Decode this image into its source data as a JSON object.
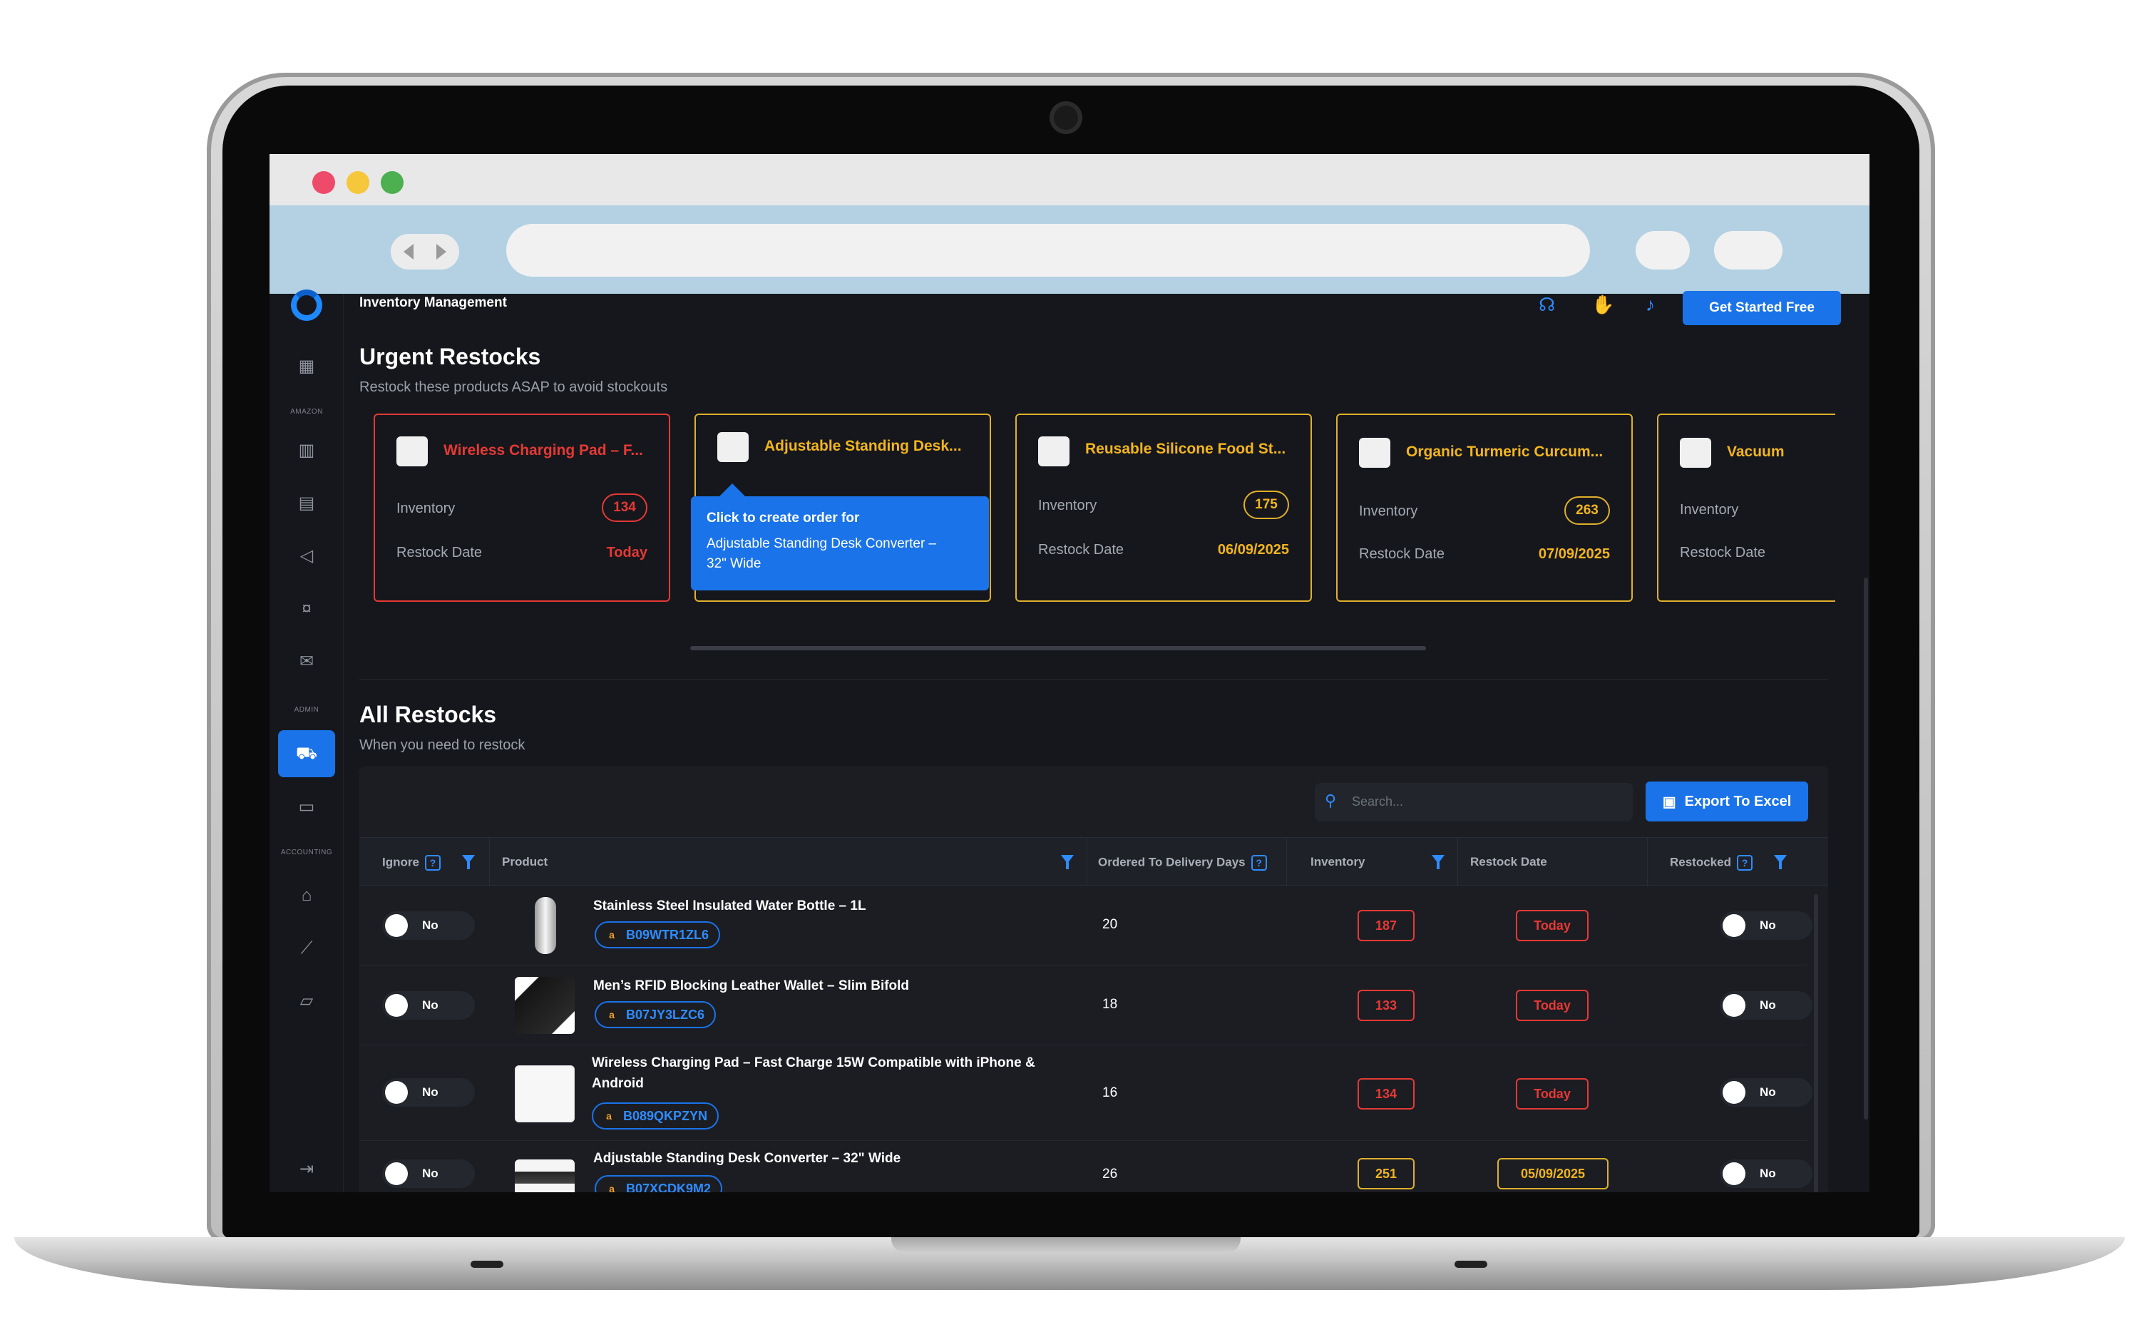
{
  "app": {
    "title": "Inventory Management",
    "cta_label": "Get Started Free"
  },
  "sidebar": {
    "sections": [
      "AMAZON",
      "ADMIN",
      "ACCOUNTING"
    ]
  },
  "urgent": {
    "title": "Urgent Restocks",
    "subtitle": "Restock these products ASAP to avoid stockouts",
    "inventory_label": "Inventory",
    "restock_date_label": "Restock Date",
    "cards": [
      {
        "name": "Wireless Charging Pad – F...",
        "inventory": "134",
        "date": "Today"
      },
      {
        "name": "Adjustable Standing Desk...",
        "inventory": "",
        "date": ""
      },
      {
        "name": "Reusable Silicone Food St...",
        "inventory": "175",
        "date": "06/09/2025"
      },
      {
        "name": "Organic Turmeric Curcum...",
        "inventory": "263",
        "date": "07/09/2025"
      },
      {
        "name": "Vacuum",
        "inventory": "",
        "date": ""
      }
    ],
    "tooltip": {
      "line1": "Click to create order for",
      "line2": "Adjustable Standing Desk Converter –",
      "line3": "32\" Wide"
    }
  },
  "all": {
    "title": "All Restocks",
    "subtitle": "When you need to restock",
    "search_placeholder": "Search...",
    "export_label": "Export To Excel",
    "columns": {
      "ignore": "Ignore",
      "product": "Product",
      "days": "Ordered To Delivery Days",
      "inventory": "Inventory",
      "restock_date": "Restock Date",
      "restocked": "Restocked"
    },
    "rows": [
      {
        "ignore": "No",
        "name": "Stainless Steel Insulated Water Bottle – 1L",
        "asin": "B09WTR1ZL6",
        "days": "20",
        "inventory": "187",
        "date": "Today",
        "restocked": "No"
      },
      {
        "ignore": "No",
        "name": "Men’s RFID Blocking Leather Wallet – Slim Bifold",
        "asin": "B07JY3LZC6",
        "days": "18",
        "inventory": "133",
        "date": "Today",
        "restocked": "No"
      },
      {
        "ignore": "No",
        "name": "Wireless Charging Pad – Fast Charge 15W Compatible with iPhone & Android",
        "asin": "B089QKPZYN",
        "days": "16",
        "inventory": "134",
        "date": "Today",
        "restocked": "No"
      },
      {
        "ignore": "No",
        "name": "Adjustable Standing Desk Converter – 32\" Wide",
        "asin": "B07XCDK9M2",
        "days": "26",
        "inventory": "251",
        "date": "05/09/2025",
        "restocked": "No"
      }
    ]
  },
  "colors": {
    "accent": "#1a73e8",
    "danger": "#e53935",
    "warning": "#f2b51e",
    "background": "#16171c"
  }
}
